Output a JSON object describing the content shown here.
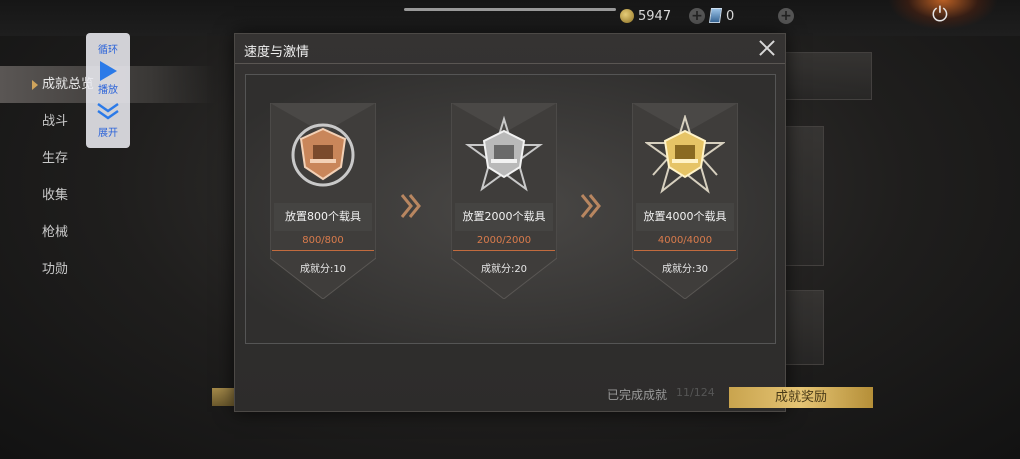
{
  "header": {
    "coins": "5947",
    "tickets": "0"
  },
  "sidebar": {
    "items": [
      {
        "label": "成就总览",
        "active": true
      },
      {
        "label": "战斗"
      },
      {
        "label": "生存"
      },
      {
        "label": "收集"
      },
      {
        "label": "枪械"
      },
      {
        "label": "功勋"
      }
    ]
  },
  "controls": {
    "loop": "循环",
    "play": "播放",
    "expand": "展开"
  },
  "modal": {
    "title": "速度与激情",
    "tiers": [
      {
        "name": "放置800个载具",
        "progress": "800/800",
        "score": "成就分:10",
        "medal": "bronze"
      },
      {
        "name": "放置2000个载具",
        "progress": "2000/2000",
        "score": "成就分:20",
        "medal": "silver"
      },
      {
        "name": "放置4000个载具",
        "progress": "4000/4000",
        "score": "成就分:30",
        "medal": "gold"
      }
    ]
  },
  "footer": {
    "completed_label": "已完成成就",
    "completed_count": "11/124",
    "reward_button": "成就奖励"
  },
  "colors": {
    "accent_gold": "#e5c474",
    "progress_orange": "#d97b4c",
    "bronze": "#c9865a",
    "silver": "#c9c9c9",
    "gold": "#e6c466"
  }
}
